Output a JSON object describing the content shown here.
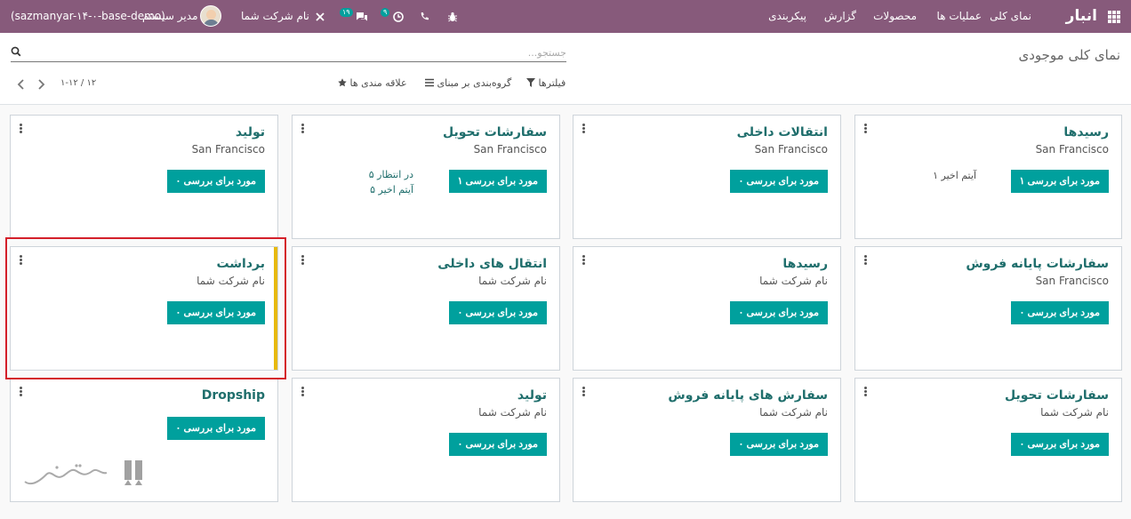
{
  "topbar": {
    "app_name": "انبار",
    "menu": [
      "نمای کلی",
      "عملیات ها",
      "محصولات",
      "گزارش",
      "پیکربندی"
    ],
    "company": "نام شرکت شما",
    "user": "مدیر سیستم",
    "db": "(sazmanyar-۱۴-۰-base-demo)",
    "activity_badge": "۹",
    "messages_badge": "۱۹"
  },
  "control": {
    "page_title": "نمای کلی موجودی",
    "search_placeholder": "جستجو...",
    "filters_label": "فیلترها",
    "groupby_label": "گروه‌بندی بر مبنای",
    "favorites_label": "علاقه مندی ها",
    "pager": "۱-۱۲ / ۱۲"
  },
  "cards": [
    {
      "title": "رسیدها",
      "subtitle": "San Francisco",
      "button": "۱ مورد برای بررسی",
      "meta": [
        "۱ آیتم اخیر"
      ]
    },
    {
      "title": "انتقالات داخلی",
      "subtitle": "San Francisco",
      "button": "۰ مورد برای بررسی",
      "meta": []
    },
    {
      "title": "سفارشات تحویل",
      "subtitle": "San Francisco",
      "button": "۱ مورد برای بررسی",
      "meta": [
        "۵ در انتظار",
        "۵ آیتم اخیر"
      ]
    },
    {
      "title": "تولید",
      "subtitle": "San Francisco",
      "button": "۰ مورد برای بررسی",
      "meta": []
    },
    {
      "title": "سفارشات پایانه فروش",
      "subtitle": "San Francisco",
      "button": "۰ مورد برای بررسی",
      "meta": []
    },
    {
      "title": "رسیدها",
      "subtitle": "نام شرکت شما",
      "button": "۰ مورد برای بررسی",
      "meta": []
    },
    {
      "title": "انتقال های داخلی",
      "subtitle": "نام شرکت شما",
      "button": "۰ مورد برای بررسی",
      "meta": []
    },
    {
      "title": "برداشت",
      "subtitle": "نام شرکت شما",
      "button": "۰ مورد برای بررسی",
      "meta": []
    },
    {
      "title": "سفارشات تحویل",
      "subtitle": "نام شرکت شما",
      "button": "۰ مورد برای بررسی",
      "meta": []
    },
    {
      "title": "سفارش های پایانه فروش",
      "subtitle": "نام شرکت شما",
      "button": "۰ مورد برای بررسی",
      "meta": []
    },
    {
      "title": "تولید",
      "subtitle": "نام شرکت شما",
      "button": "۰ مورد برای بررسی",
      "meta": []
    },
    {
      "title": "Dropship",
      "subtitle": "",
      "button": "۰ مورد برای بررسی",
      "meta": []
    }
  ],
  "colors": {
    "topbar": "#875a7b",
    "button": "#00a09d",
    "title": "#1f6e6c",
    "stripe": "#e7b90c",
    "highlight": "#d4202a"
  }
}
